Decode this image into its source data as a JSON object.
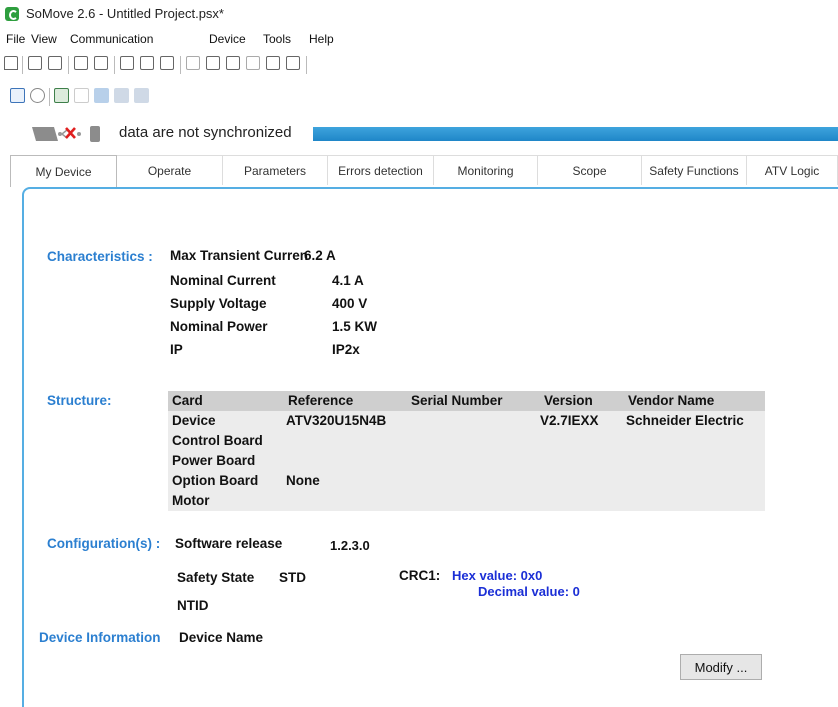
{
  "window": {
    "title": "SoMove 2.6 - Untitled Project.psx*"
  },
  "menu": [
    "File",
    "View",
    "Communication",
    "Device",
    "Tools",
    "Help"
  ],
  "status": {
    "sync_text": "data are not synchronized"
  },
  "tabs": [
    "My Device",
    "Operate",
    "Parameters",
    "Errors detection",
    "Monitoring",
    "Scope",
    "Safety Functions",
    "ATV Logic"
  ],
  "characteristics": {
    "label": "Characteristics :",
    "rows": [
      {
        "name": "Max Transient Curren",
        "value": "6.2 A"
      },
      {
        "name": "Nominal Current",
        "value": "4.1 A"
      },
      {
        "name": "Supply Voltage",
        "value": "400 V"
      },
      {
        "name": "Nominal Power",
        "value": "1.5 KW"
      },
      {
        "name": "IP",
        "value": "IP2x"
      }
    ]
  },
  "structure": {
    "label": "Structure:",
    "headers": [
      "Card",
      "Reference",
      "Serial Number",
      "Version",
      "Vendor Name"
    ],
    "rows": [
      [
        "Device",
        "ATV320U15N4B",
        "",
        "V2.7IEXX",
        "Schneider Electric"
      ],
      [
        "Control Board",
        "",
        "",
        "",
        ""
      ],
      [
        "Power Board",
        "",
        "",
        "",
        ""
      ],
      [
        "Option Board",
        "None",
        "",
        "",
        ""
      ],
      [
        "Motor",
        "",
        "",
        "",
        ""
      ]
    ]
  },
  "configuration": {
    "label": "Configuration(s) :",
    "software_release_label": "Software release",
    "software_release_value": "1.2.3.0",
    "safety_state_label": "Safety State",
    "safety_state_value": "STD",
    "crc_label": "CRC1:",
    "crc_hex": "Hex value: 0x0",
    "crc_dec": "Decimal value: 0",
    "ntid_label": "NTID"
  },
  "device_information": {
    "label": "Device Information",
    "device_name_label": "Device Name"
  },
  "buttons": {
    "modify": "Modify ..."
  },
  "colors": {
    "accent": "#2b7fd0",
    "value_blue": "#1b2fd6",
    "sync_bar": "#2a93d4",
    "table_header": "#cfcfcf"
  }
}
